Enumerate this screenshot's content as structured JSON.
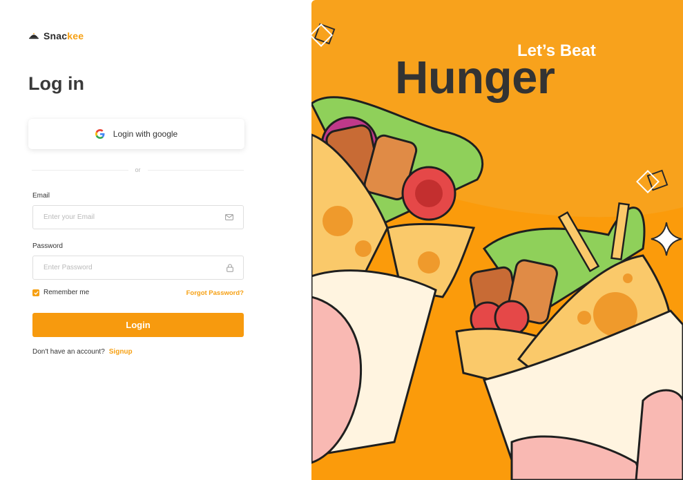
{
  "brand": {
    "name_main": "Snac",
    "name_accent": "kee",
    "logo_icon": "cloche-icon"
  },
  "page": {
    "title": "Log in"
  },
  "google": {
    "label": "Login with google",
    "icon": "google-icon"
  },
  "divider": {
    "text": "or"
  },
  "email": {
    "label": "Email",
    "placeholder": "Enter your Email",
    "value": "",
    "icon": "mail-icon"
  },
  "password": {
    "label": "Password",
    "placeholder": "Enter Password",
    "value": "",
    "icon": "lock-icon"
  },
  "remember": {
    "label": "Remember me",
    "checked": true
  },
  "forgot": {
    "label": "Forgot Password?"
  },
  "login": {
    "label": "Login"
  },
  "signup": {
    "prompt": "Don't have an account?",
    "link": "Signup"
  },
  "hero": {
    "small": "Let’s Beat",
    "big": "Hunger"
  },
  "colors": {
    "accent": "#f6a013",
    "panel": "#f8a21c",
    "text_dark": "#333333"
  }
}
